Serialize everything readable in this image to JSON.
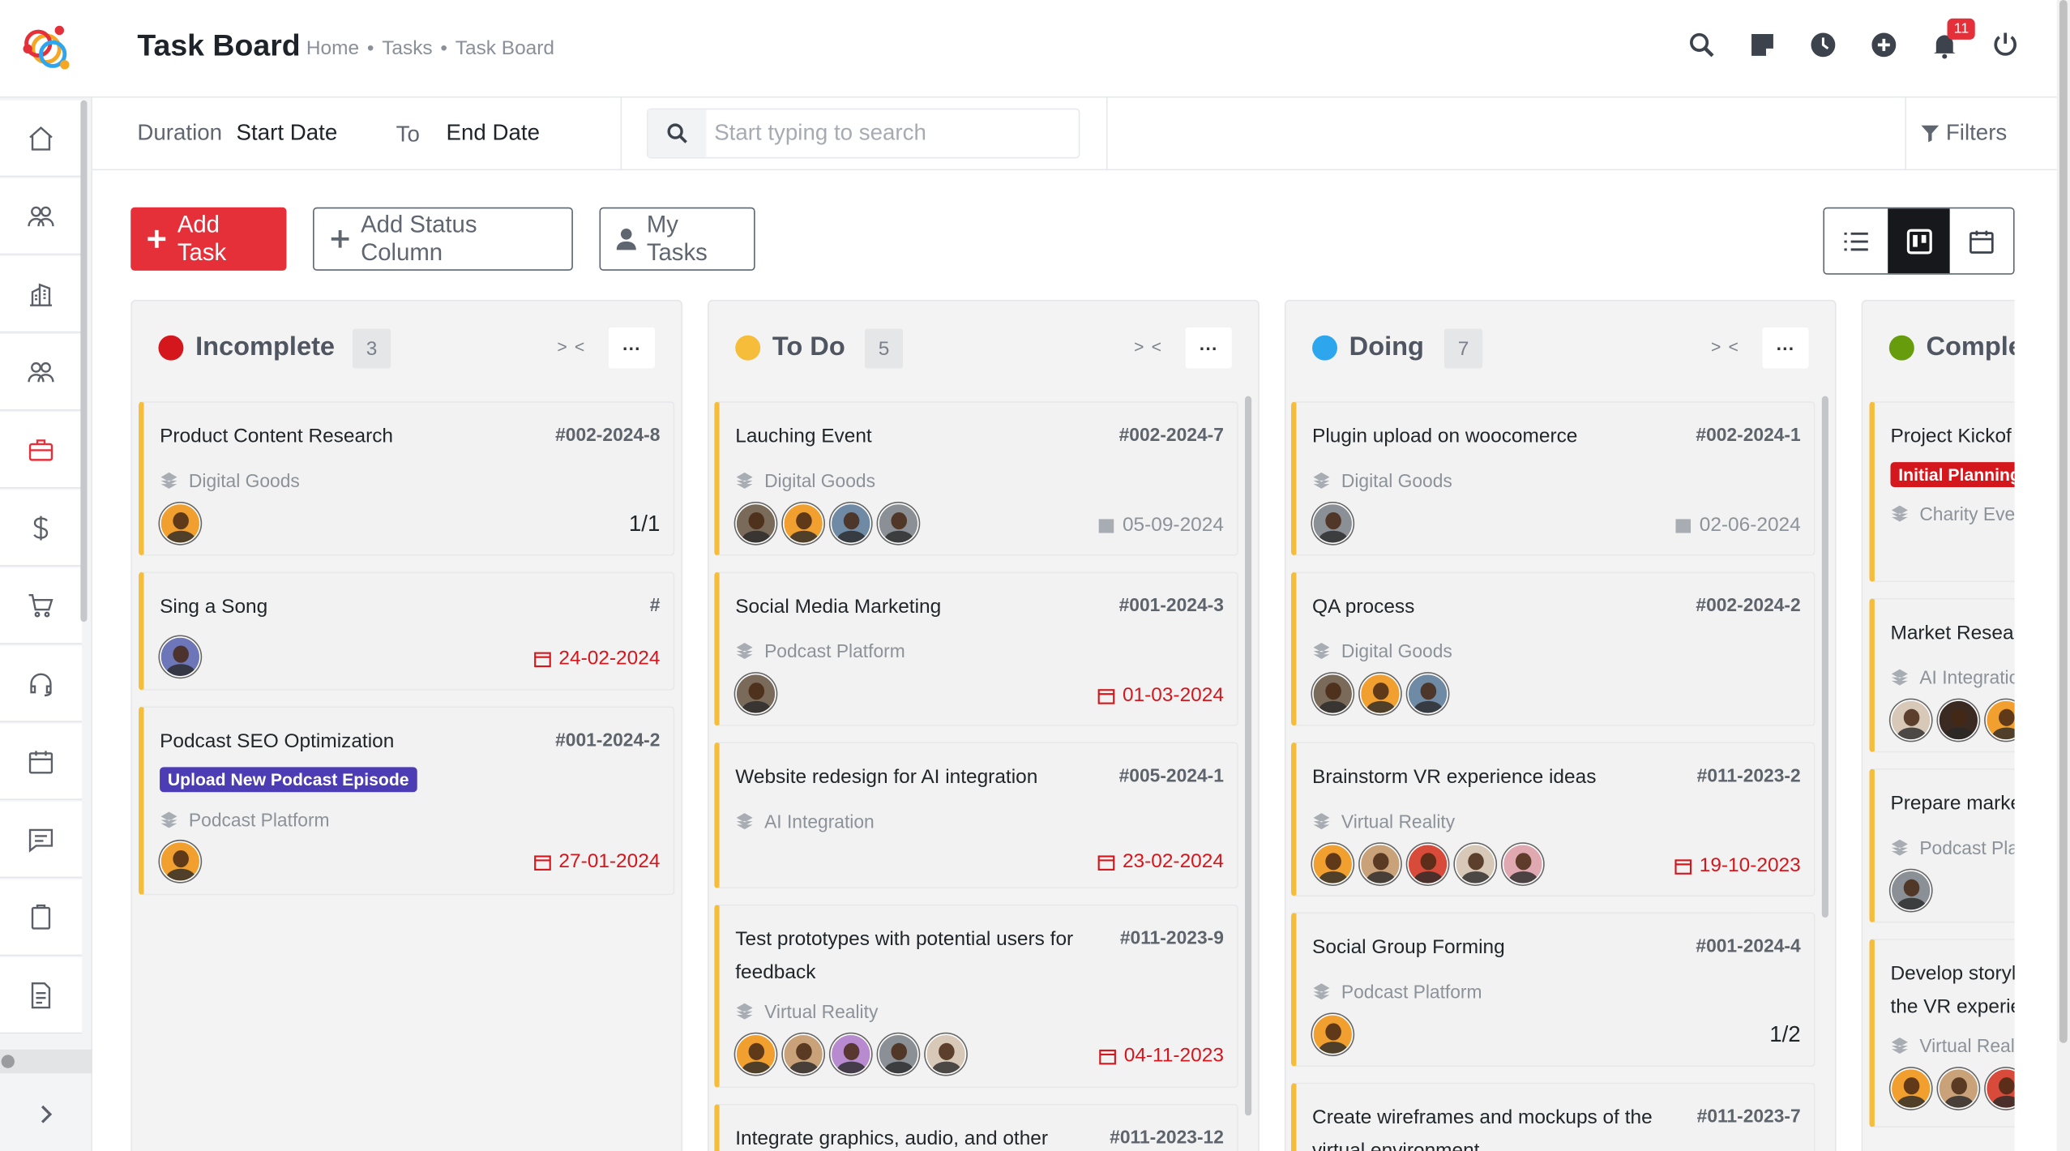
{
  "header": {
    "title": "Task Board",
    "breadcrumb": [
      "Home",
      "Tasks",
      "Task Board"
    ],
    "notification_count": "11",
    "icons": [
      "search-icon",
      "sticky-note-icon",
      "clock-icon",
      "plus-circle-icon",
      "bell-icon",
      "power-icon"
    ]
  },
  "sidebar": {
    "items": [
      "home-icon",
      "clients-icon",
      "building-icon",
      "users-icon",
      "briefcase-icon",
      "dollar-icon",
      "cart-icon",
      "headset-icon",
      "calendar-icon",
      "chat-icon",
      "clipboard-icon",
      "document-icon"
    ],
    "active": "briefcase-icon",
    "accent": "#e5303a"
  },
  "filterbar": {
    "duration_label": "Duration",
    "start_date": "Start Date",
    "to_label": "To",
    "end_date": "End Date",
    "search_placeholder": "Start typing to search",
    "filters_label": "Filters"
  },
  "toolbar": {
    "add_task": "Add Task",
    "add_status_column": "Add Status Column",
    "my_tasks": "My Tasks",
    "views": [
      "list-view-icon",
      "board-view-icon",
      "calendar-view-icon"
    ],
    "active_view": "board-view-icon"
  },
  "columns": [
    {
      "title": "Incomplete",
      "count": "3",
      "color": "#d3171d",
      "collapse": "> <",
      "menu": "···",
      "cards": [
        {
          "title": "Product Content Research",
          "id": "#002-2024-8",
          "project": "Digital Goods",
          "avatars": 1,
          "right": "1/1",
          "right_type": "sub"
        },
        {
          "title": "Sing a Song",
          "id": "#",
          "project": "",
          "avatars": 1,
          "right": "24-02-2024",
          "right_type": "due-red"
        },
        {
          "title": "Podcast SEO Optimization",
          "id": "#001-2024-2",
          "tag": "Upload New Podcast Episode",
          "tag_color": "#4c3db4",
          "project": "Podcast Platform",
          "avatars": 1,
          "right": "27-01-2024",
          "right_type": "due-red"
        }
      ]
    },
    {
      "title": "To Do",
      "count": "5",
      "color": "#f5bd3a",
      "collapse": "> <",
      "menu": "···",
      "cards": [
        {
          "title": "Lauching Event",
          "id": "#002-2024-7",
          "project": "Digital Goods",
          "avatars": 4,
          "right": "05-09-2024",
          "right_type": "due-grey"
        },
        {
          "title": "Social Media Marketing",
          "id": "#001-2024-3",
          "project": "Podcast Platform",
          "avatars": 1,
          "right": "01-03-2024",
          "right_type": "due-red"
        },
        {
          "title": "Website redesign for AI integration",
          "id": "#005-2024-1",
          "project": "AI Integration",
          "avatars": 0,
          "right": "23-02-2024",
          "right_type": "due-red"
        },
        {
          "title": "Test prototypes with potential users for feedback",
          "id": "#011-2023-9",
          "project": "Virtual Reality",
          "avatars": 5,
          "right": "04-11-2023",
          "right_type": "due-red"
        },
        {
          "title": "Integrate graphics, audio, and other",
          "id": "#011-2023-12",
          "project": "",
          "avatars": 0,
          "right": "",
          "right_type": ""
        }
      ]
    },
    {
      "title": "Doing",
      "count": "7",
      "color": "#2ea6ee",
      "collapse": "> <",
      "menu": "···",
      "cards": [
        {
          "title": "Plugin upload on woocomerce",
          "id": "#002-2024-1",
          "project": "Digital Goods",
          "avatars": 1,
          "right": "02-06-2024",
          "right_type": "due-grey"
        },
        {
          "title": "QA process",
          "id": "#002-2024-2",
          "project": "Digital Goods",
          "avatars": 3,
          "right": "",
          "right_type": ""
        },
        {
          "title": "Brainstorm VR experience ideas",
          "id": "#011-2023-2",
          "project": "Virtual Reality",
          "avatars": 5,
          "right": "19-10-2023",
          "right_type": "due-red"
        },
        {
          "title": "Social Group Forming",
          "id": "#001-2024-4",
          "project": "Podcast Platform",
          "avatars": 1,
          "right": "1/2",
          "right_type": "sub"
        },
        {
          "title": "Create wireframes and mockups of the virtual environment",
          "id": "#011-2023-7",
          "project": "",
          "avatars": 0,
          "right": "",
          "right_type": ""
        }
      ]
    },
    {
      "title": "Comple",
      "color": "#679c0d",
      "cards": [
        {
          "title": "Project Kickof",
          "tag": "Initial Planning",
          "tag_color": "#d3171d",
          "project": "Charity Ever"
        },
        {
          "title": "Market Resear",
          "project": "AI Integratio"
        },
        {
          "title": "Prepare marke",
          "project": "Podcast Pla"
        },
        {
          "title": "Develop storyl",
          "title2": "the VR experie",
          "project": "Virtual Reali"
        }
      ]
    }
  ]
}
